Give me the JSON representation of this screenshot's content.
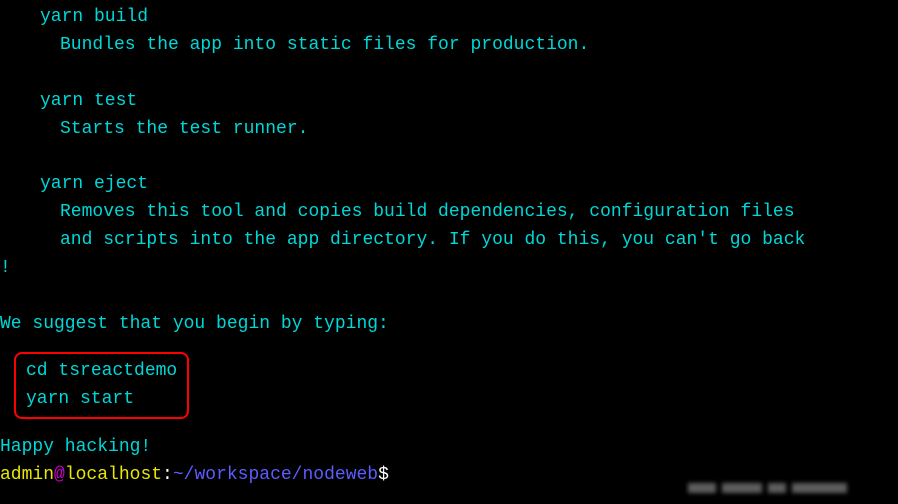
{
  "commands": {
    "build": {
      "name": "yarn build",
      "desc": "Bundles the app into static files for production."
    },
    "test": {
      "name": "yarn test",
      "desc": "Starts the test runner."
    },
    "eject": {
      "name": "yarn eject",
      "desc1": "Removes this tool and copies build dependencies, configuration files",
      "desc2": "and scripts into the app directory. If you do this, you can't go back",
      "desc3": "!"
    }
  },
  "suggest": "We suggest that you begin by typing:",
  "boxed": {
    "line1_cmd": "cd",
    "line1_arg": " tsreactdemo",
    "line2": "yarn start"
  },
  "happy": "Happy hacking!",
  "prompt": {
    "user": "admin",
    "at": "@",
    "host": "localhost",
    "colon": ":",
    "path": "~/workspace/nodeweb",
    "dollar": "$"
  }
}
